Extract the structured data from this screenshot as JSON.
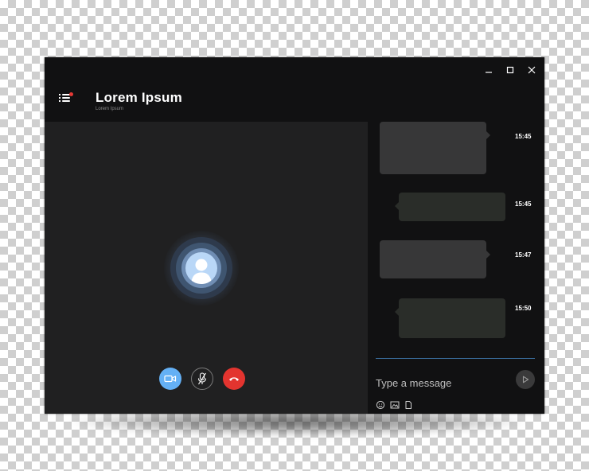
{
  "header": {
    "title": "Lorem Ipsum",
    "subtitle": "Lorem Ipsum",
    "notification_color": "#e53935"
  },
  "window_controls": [
    "minimize-icon",
    "maximize-icon",
    "close-icon"
  ],
  "call": {
    "avatar_icon": "user-silhouette-icon",
    "buttons": [
      {
        "name": "video",
        "icon": "video-camera-icon",
        "color": "#64b0f5"
      },
      {
        "name": "mute",
        "icon": "microphone-off-icon",
        "color": "#202021"
      },
      {
        "name": "end-call",
        "icon": "phone-hangup-icon",
        "color": "#e3342f"
      }
    ]
  },
  "chat": {
    "messages": [
      {
        "direction": "incoming",
        "time": "15:45"
      },
      {
        "direction": "outgoing",
        "time": "15:45"
      },
      {
        "direction": "incoming",
        "time": "15:47"
      },
      {
        "direction": "outgoing",
        "time": "15:50"
      }
    ],
    "input_placeholder": "Type a message",
    "tools": [
      "emoji-icon",
      "image-icon",
      "attachment-icon"
    ],
    "send_icon": "send-icon",
    "divider_color": "#3a6e9e"
  }
}
